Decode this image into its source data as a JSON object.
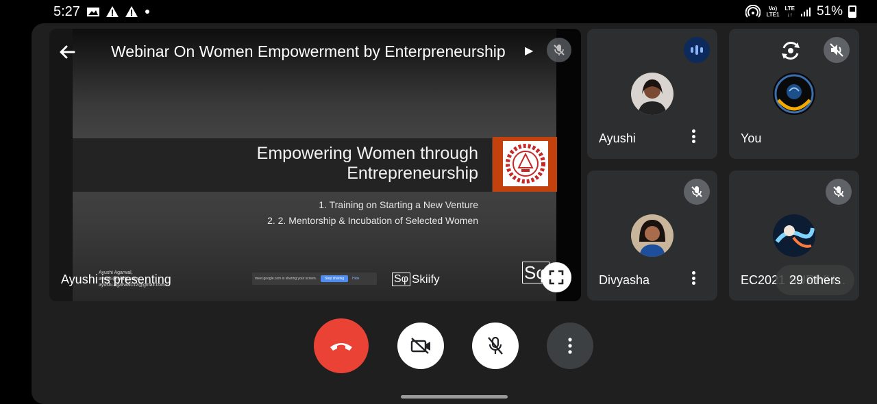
{
  "status_bar": {
    "time": "5:27",
    "left_icons": [
      "image-icon",
      "warning-icon",
      "warning-icon",
      "dot-icon"
    ],
    "network_top": "Vo)",
    "network_lte": "LTE",
    "network_sub": "LTE1",
    "battery": "51%"
  },
  "meeting": {
    "title": "Webinar On Women Empowerment by Enterpreneurship",
    "presenting_label": "Ayushi is presenting"
  },
  "slide": {
    "title_line1": "Empowering Women through",
    "title_line2": "Entrepreneurship",
    "bullet1": "1.   Training on Starting a New Venture",
    "bullet2": "2.   2. Mentorship & Incubation of Selected Women",
    "credit_name": "Ayushi Agarwal,",
    "credit_line2": "ayushi@skiify.com",
    "credit_email": "ayushi.agarwal112@gmail.com",
    "share_notice": "meet.google.com is sharing your screen.",
    "share_stop": "Stop sharing",
    "share_hide": "Hide",
    "brand_mark": "Sφ",
    "brand_name": "Skiify"
  },
  "participants": [
    {
      "name": "Ayushi",
      "state": "speaking"
    },
    {
      "name": "You",
      "state": "speaker-off"
    },
    {
      "name": "Divyasha",
      "state": "muted"
    },
    {
      "name": "EC2021...",
      "state": "muted"
    }
  ],
  "others_label": "29 others",
  "others_name": "EC2021 SURIYH...",
  "colors": {
    "app_bg": "#1f1f1f",
    "tile_bg": "#2d2e30",
    "hangup": "#ea4335",
    "muted_badge": "#5f6368",
    "speaking_blue": "#8ab4f8",
    "slide_logo_bg": "#c2410c"
  }
}
